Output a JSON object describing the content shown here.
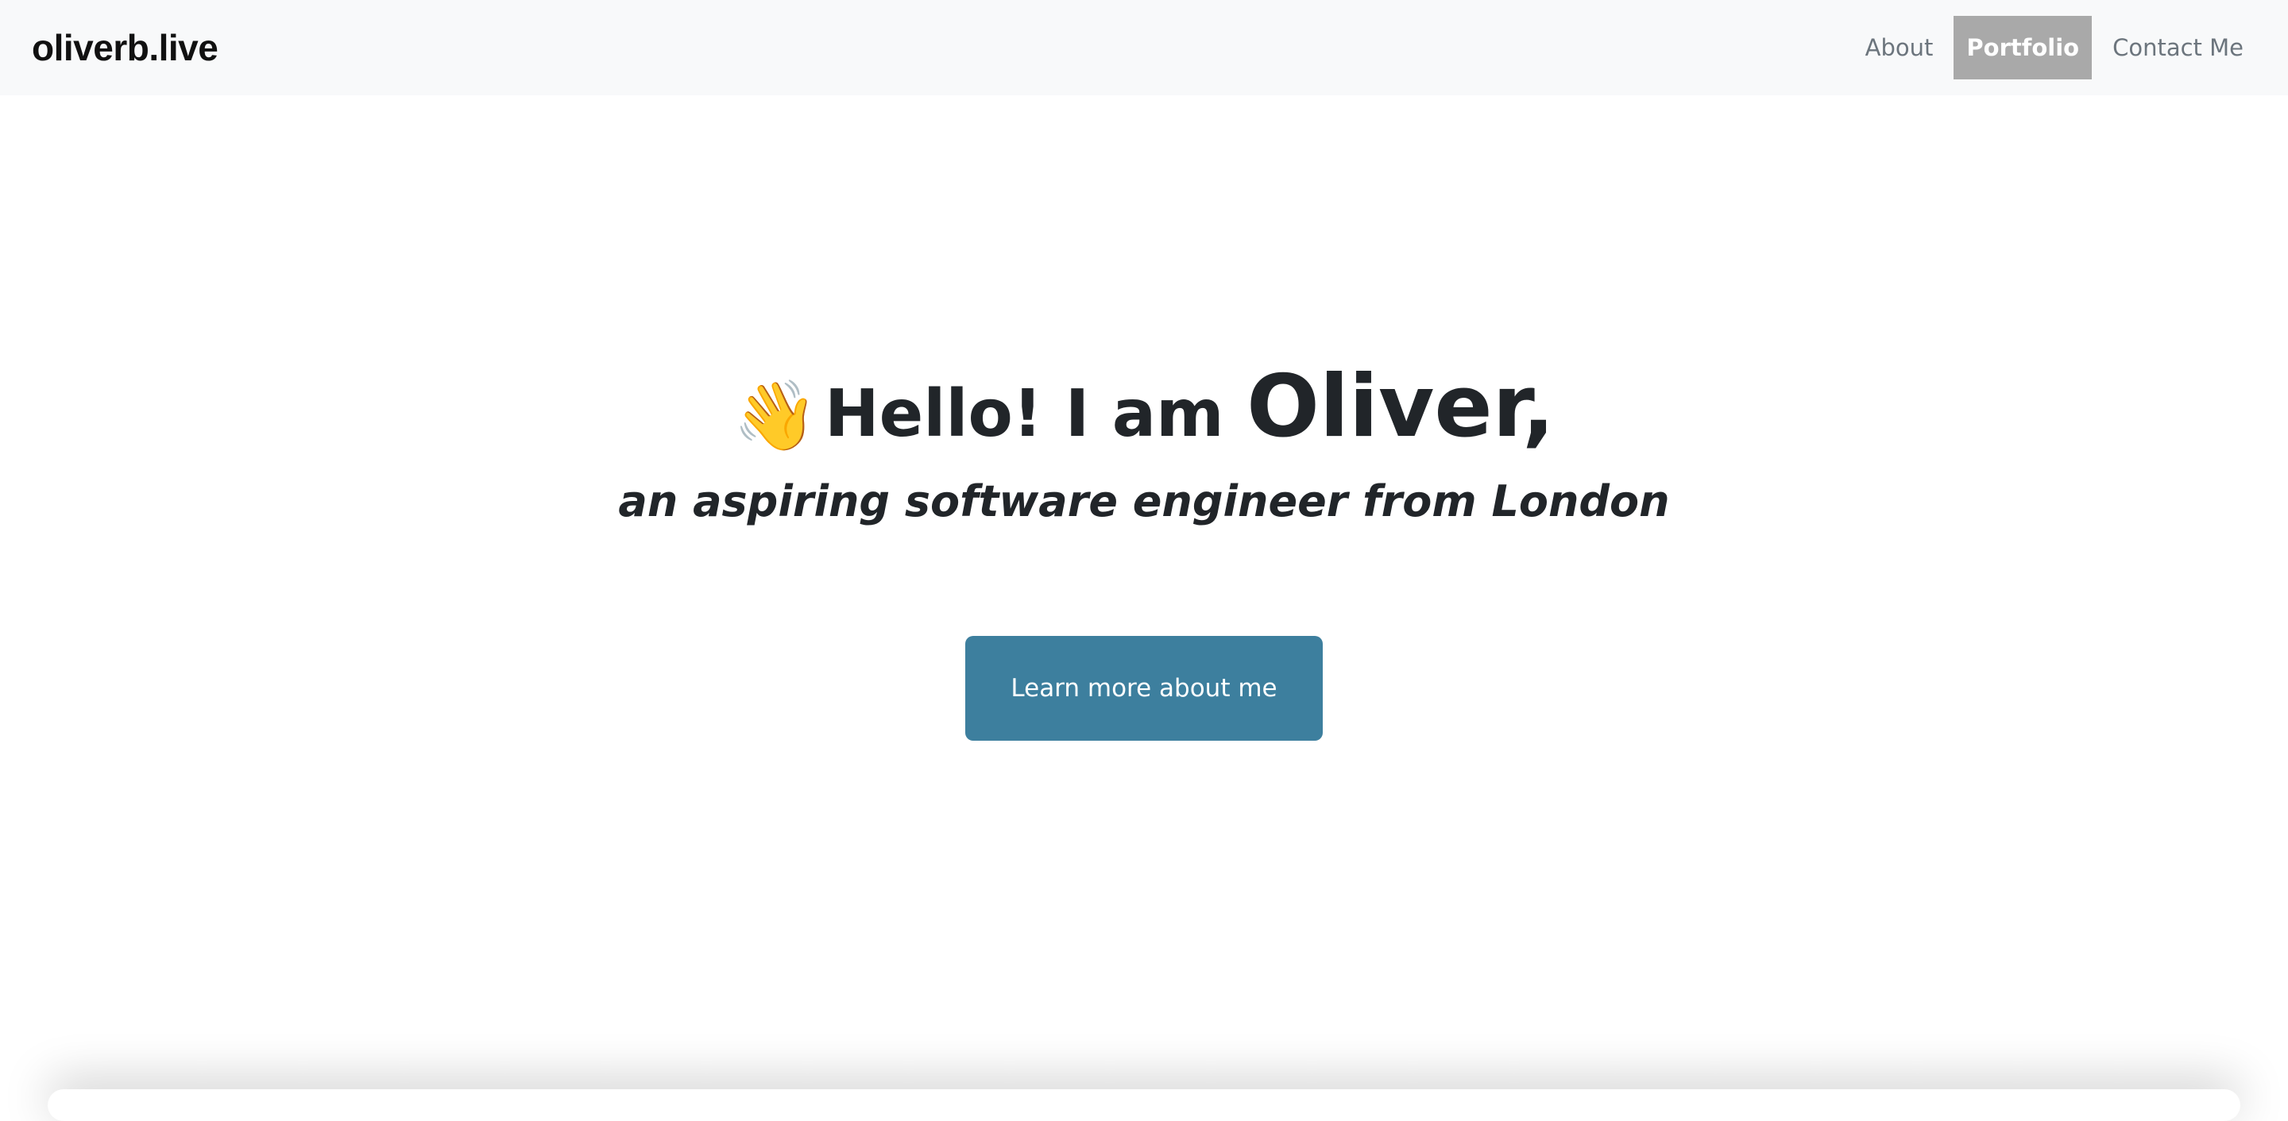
{
  "navbar": {
    "brand": "oliverb.live",
    "links": [
      {
        "label": "About"
      },
      {
        "label": "Portfolio"
      },
      {
        "label": "Contact Me"
      }
    ],
    "active_link": "Portfolio"
  },
  "hero": {
    "wave_icon": "waving-hand-icon",
    "wave_glyph": "👋",
    "greeting": "Hello! I am ",
    "name": "Oliver,",
    "subtitle": "an aspiring software engineer from London",
    "cta_label": "Learn more about me"
  },
  "colors": {
    "navbar_bg": "#f8f9fa",
    "active_link_bg": "#a9a9a9",
    "cta_bg": "#3d7f9e",
    "text": "#212529"
  }
}
